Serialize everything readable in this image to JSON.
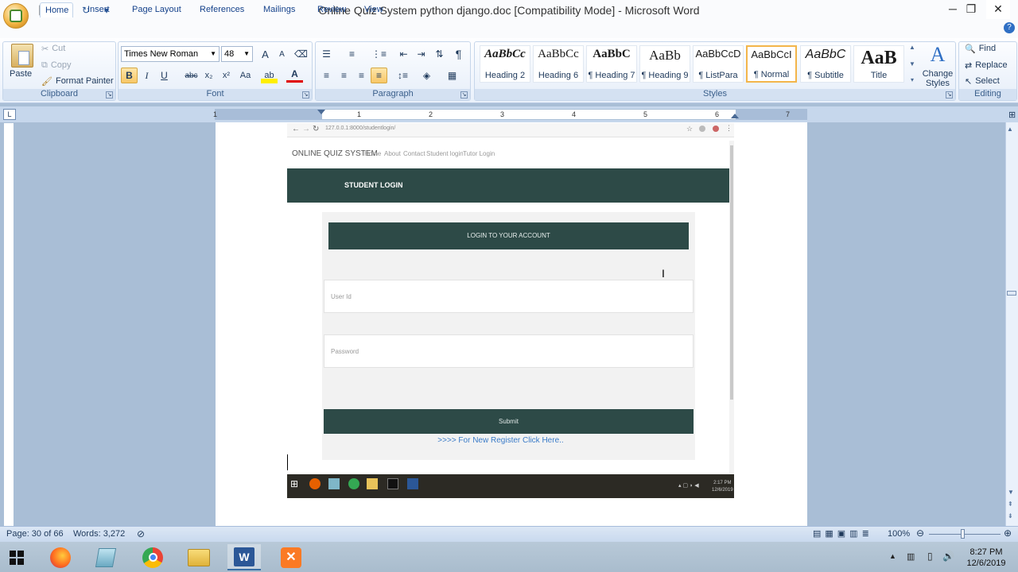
{
  "window": {
    "title": "Online Quiz System python django.doc [Compatibility Mode] - Microsoft Word",
    "minimize": "─",
    "restore": "❐",
    "close": "✕",
    "help": "?"
  },
  "qat": {
    "save": "💾",
    "undo": "↶",
    "redo": "↻",
    "more": "▾"
  },
  "tabs": [
    "Home",
    "Insert",
    "Page Layout",
    "References",
    "Mailings",
    "Review",
    "View"
  ],
  "ribbon": {
    "clipboard": {
      "label": "Clipboard",
      "paste": "Paste",
      "cut": "Cut",
      "copy": "Copy",
      "format_painter": "Format Painter"
    },
    "font": {
      "label": "Font",
      "font_name": "Times New Roman",
      "font_size": "48",
      "grow": "A",
      "shrink": "A",
      "bold": "B",
      "italic": "I",
      "underline": "U",
      "strike": "abc",
      "subscript": "x₂",
      "superscript": "x²",
      "change_case": "Aa",
      "highlight": "ab",
      "font_color": "A"
    },
    "paragraph": {
      "label": "Paragraph",
      "pilcrow": "¶"
    },
    "styles": {
      "label": "Styles",
      "items": [
        {
          "preview": "AaBbCc",
          "name": "Heading 2"
        },
        {
          "preview": "AaBbCc",
          "name": "Heading 6"
        },
        {
          "preview": "AaBbC",
          "name": "¶ Heading 7"
        },
        {
          "preview": "AaBb",
          "name": "¶ Heading 9"
        },
        {
          "preview": "AaBbCcD",
          "name": "¶ ListPara"
        },
        {
          "preview": "AaBbCcI",
          "name": "¶ Normal"
        },
        {
          "preview": "AaBbC",
          "name": "¶ Subtitle"
        },
        {
          "preview": "AaB",
          "name": "Title"
        }
      ],
      "change_styles": "Change Styles"
    },
    "editing": {
      "label": "Editing",
      "find": "Find",
      "replace": "Replace",
      "select": "Select"
    }
  },
  "ruler": {
    "ticks": [
      "1",
      "1",
      "2",
      "3",
      "4",
      "5",
      "6",
      "7"
    ],
    "tab_selector": "L"
  },
  "embedded": {
    "url": "127.0.0.1:8000/studentlogin/",
    "site_name": "ONLINE QUIZ SYSTEM",
    "nav": [
      "Home",
      "About",
      "Contact",
      "Student login",
      "Tutor Login"
    ],
    "banner": "STUDENT LOGIN",
    "form_title": "LOGIN TO YOUR ACCOUNT",
    "userid_placeholder": "User Id",
    "password_placeholder": "Password",
    "submit": "Submit",
    "register_link": ">>>> For New Register Click Here..",
    "time": "2:17 PM",
    "date": "12/6/2019"
  },
  "status": {
    "page": "Page: 30 of 66",
    "words": "Words: 3,272",
    "zoom": "100%"
  },
  "taskbar": {
    "time": "8:27 PM",
    "date": "12/6/2019"
  },
  "colors": {
    "accent_green": "#2d4a47",
    "ribbon_blue": "#1e395b",
    "link_blue": "#3a7bc8"
  }
}
